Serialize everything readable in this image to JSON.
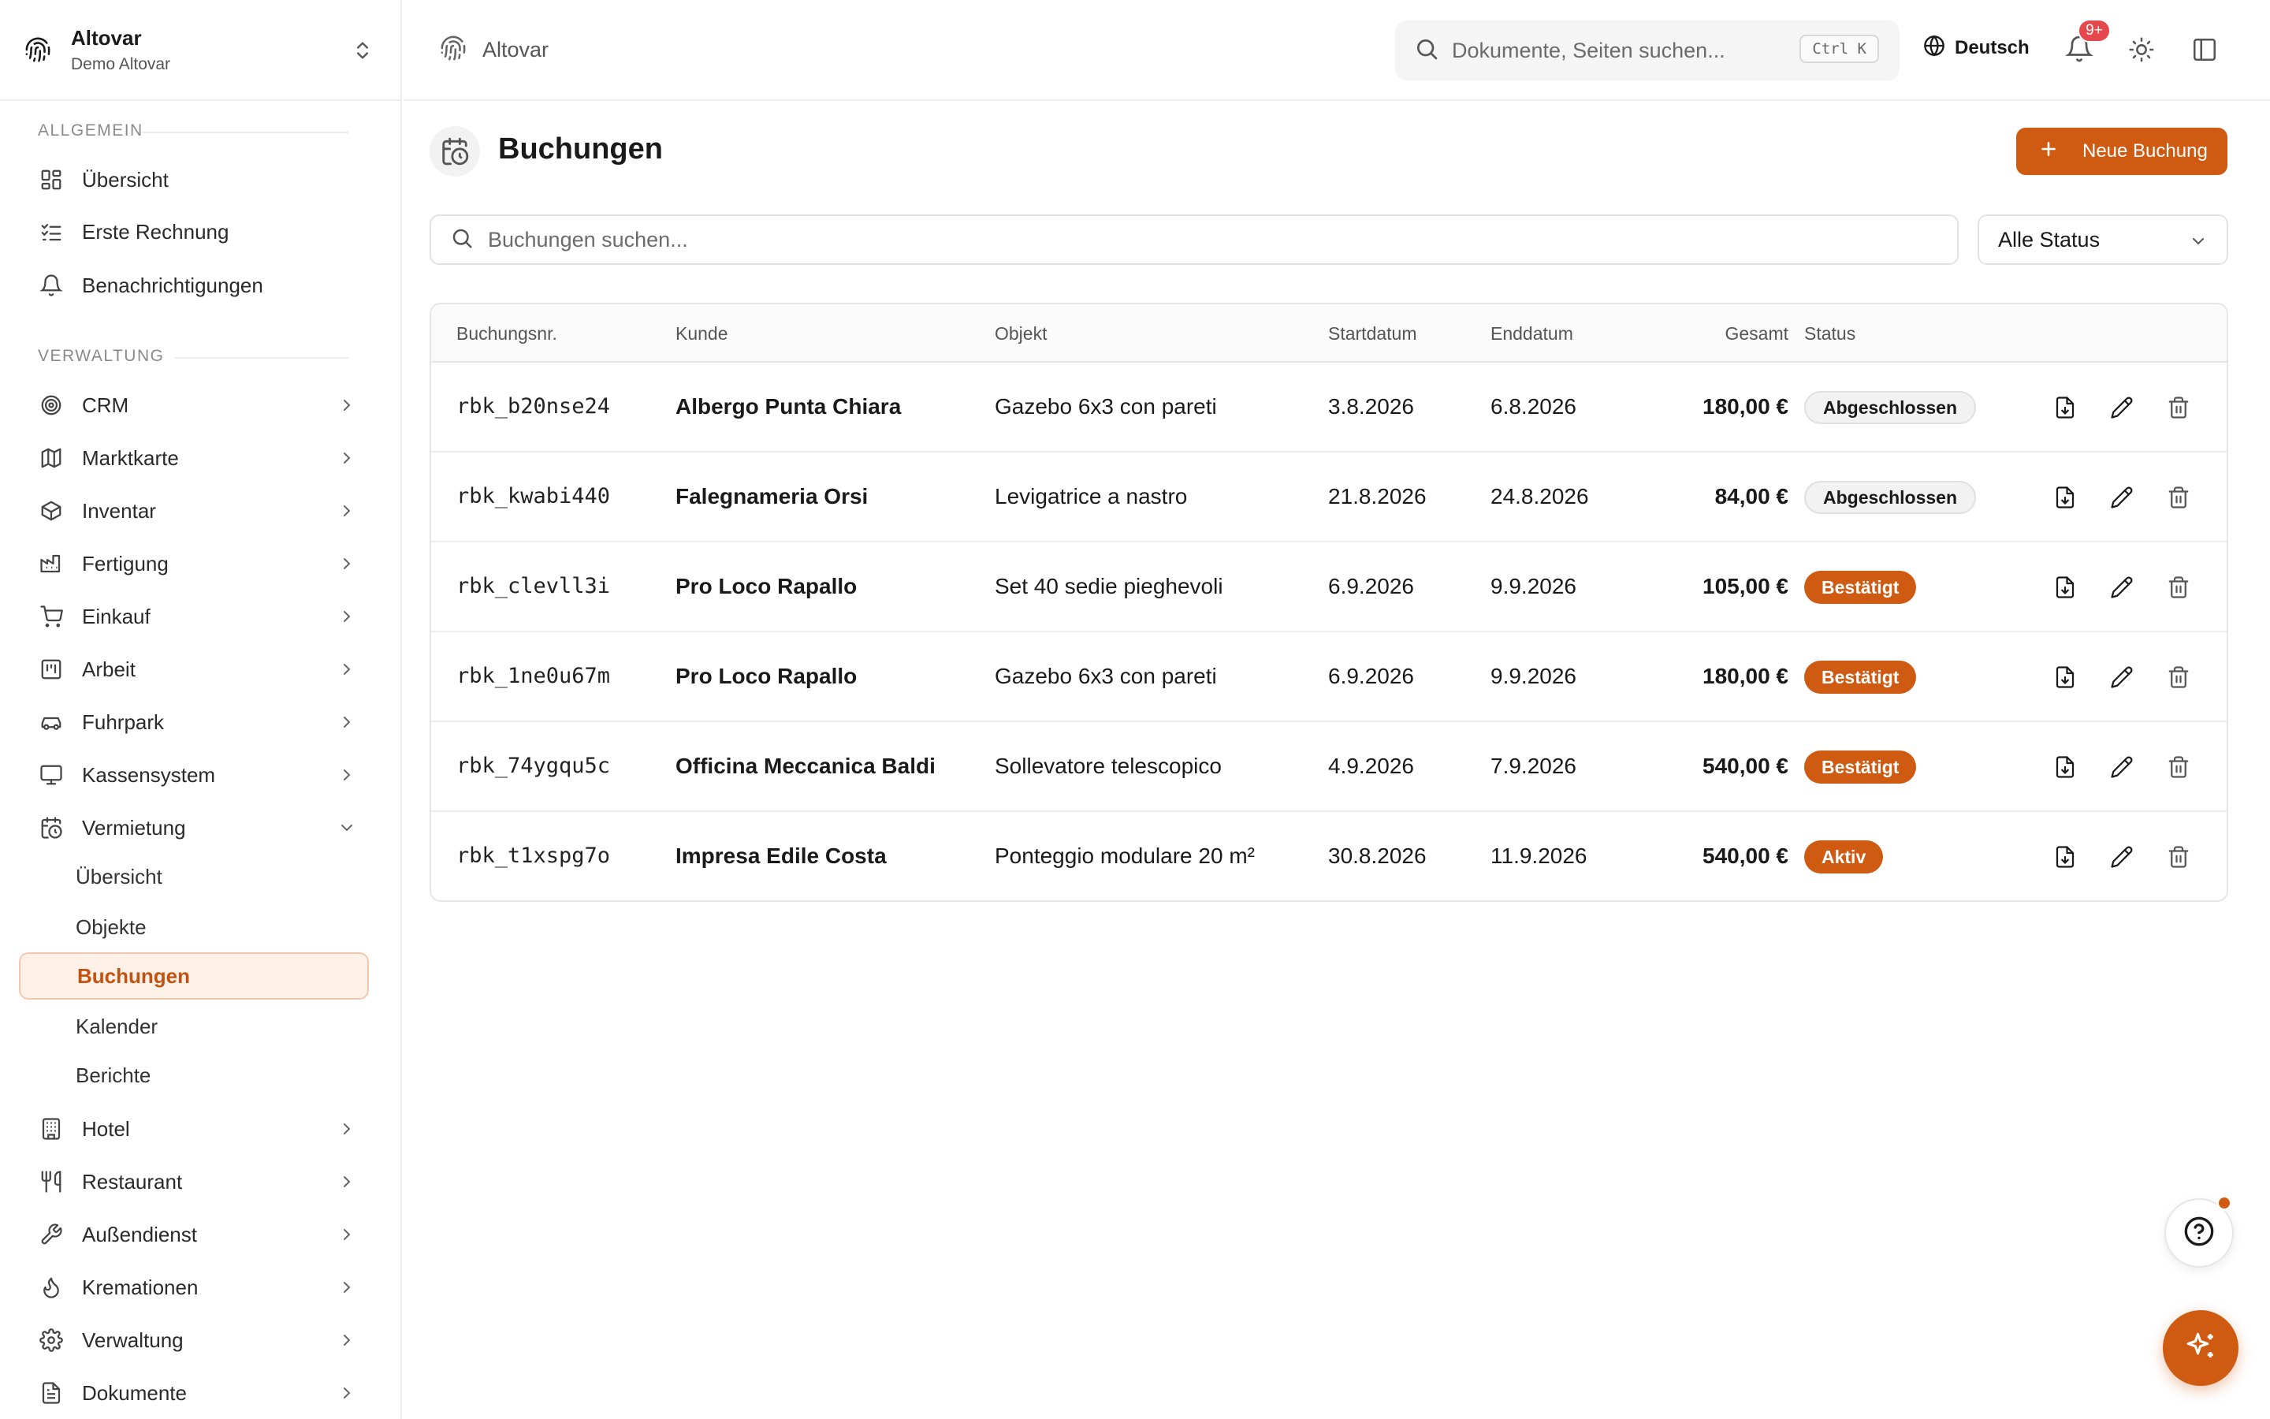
{
  "org": {
    "name": "Altovar",
    "subtitle": "Demo Altovar"
  },
  "sidebar": {
    "sections": {
      "general": "ALLGEMEIN",
      "admin": "VERWALTUNG"
    },
    "general_items": [
      {
        "label": "Übersicht",
        "icon": "dashboard-icon"
      },
      {
        "label": "Erste Rechnung",
        "icon": "checklist-icon"
      },
      {
        "label": "Benachrichtigungen",
        "icon": "bell-icon"
      }
    ],
    "admin_items": [
      {
        "label": "CRM",
        "icon": "target-icon"
      },
      {
        "label": "Marktkarte",
        "icon": "map-icon"
      },
      {
        "label": "Inventar",
        "icon": "box-icon"
      },
      {
        "label": "Fertigung",
        "icon": "factory-icon"
      },
      {
        "label": "Einkauf",
        "icon": "cart-icon"
      },
      {
        "label": "Arbeit",
        "icon": "clipboard-icon"
      },
      {
        "label": "Fuhrpark",
        "icon": "car-icon"
      },
      {
        "label": "Kassensystem",
        "icon": "monitor-icon"
      },
      {
        "label": "Vermietung",
        "icon": "calendar-clock-icon"
      }
    ],
    "rental_sub": [
      "Übersicht",
      "Objekte",
      "Buchungen",
      "Kalender",
      "Berichte"
    ],
    "bottom_items": [
      {
        "label": "Hotel",
        "icon": "building-icon"
      },
      {
        "label": "Restaurant",
        "icon": "utensils-icon"
      },
      {
        "label": "Außendienst",
        "icon": "wrench-icon"
      },
      {
        "label": "Kremationen",
        "icon": "flame-icon"
      },
      {
        "label": "Verwaltung",
        "icon": "gear-icon"
      },
      {
        "label": "Dokumente",
        "icon": "document-icon"
      }
    ]
  },
  "topbar": {
    "breadcrumb": "Altovar",
    "search_placeholder": "Dokumente, Seiten suchen...",
    "shortcut": "Ctrl K",
    "language": "Deutsch",
    "notifications_badge": "9+"
  },
  "main": {
    "title": "Buchungen",
    "new_button": "Neue Buchung",
    "search_placeholder": "Buchungen suchen...",
    "status_filter": "Alle Status",
    "columns": [
      "Buchungsnr.",
      "Kunde",
      "Objekt",
      "Startdatum",
      "Enddatum",
      "Gesamt",
      "Status"
    ],
    "rows": [
      {
        "id": "rbk_b20nse24",
        "customer": "Albergo Punta Chiara",
        "item": "Gazebo 6x3 con pareti",
        "start": "3.8.2026",
        "end": "6.8.2026",
        "total": "180,00 €",
        "status": "Abgeschlossen",
        "kind": "done"
      },
      {
        "id": "rbk_kwabi440",
        "customer": "Falegnameria Orsi",
        "item": "Levigatrice a nastro",
        "start": "21.8.2026",
        "end": "24.8.2026",
        "total": "84,00 €",
        "status": "Abgeschlossen",
        "kind": "done"
      },
      {
        "id": "rbk_clevll3i",
        "customer": "Pro Loco Rapallo",
        "item": "Set 40 sedie pieghevoli",
        "start": "6.9.2026",
        "end": "9.9.2026",
        "total": "105,00 €",
        "status": "Bestätigt",
        "kind": "ok"
      },
      {
        "id": "rbk_1ne0u67m",
        "customer": "Pro Loco Rapallo",
        "item": "Gazebo 6x3 con pareti",
        "start": "6.9.2026",
        "end": "9.9.2026",
        "total": "180,00 €",
        "status": "Bestätigt",
        "kind": "ok"
      },
      {
        "id": "rbk_74ygqu5c",
        "customer": "Officina Meccanica Baldi",
        "item": "Sollevatore telescopico",
        "start": "4.9.2026",
        "end": "7.9.2026",
        "total": "540,00 €",
        "status": "Bestätigt",
        "kind": "ok"
      },
      {
        "id": "rbk_t1xspg7o",
        "customer": "Impresa Edile Costa",
        "item": "Ponteggio modulare 20 m²",
        "start": "30.8.2026",
        "end": "11.9.2026",
        "total": "540,00 €",
        "status": "Aktiv",
        "kind": "ok"
      }
    ]
  },
  "colors": {
    "accent": "#cf5a12",
    "active_bg": "#fdf0e7",
    "badge_red": "#e5484d"
  }
}
